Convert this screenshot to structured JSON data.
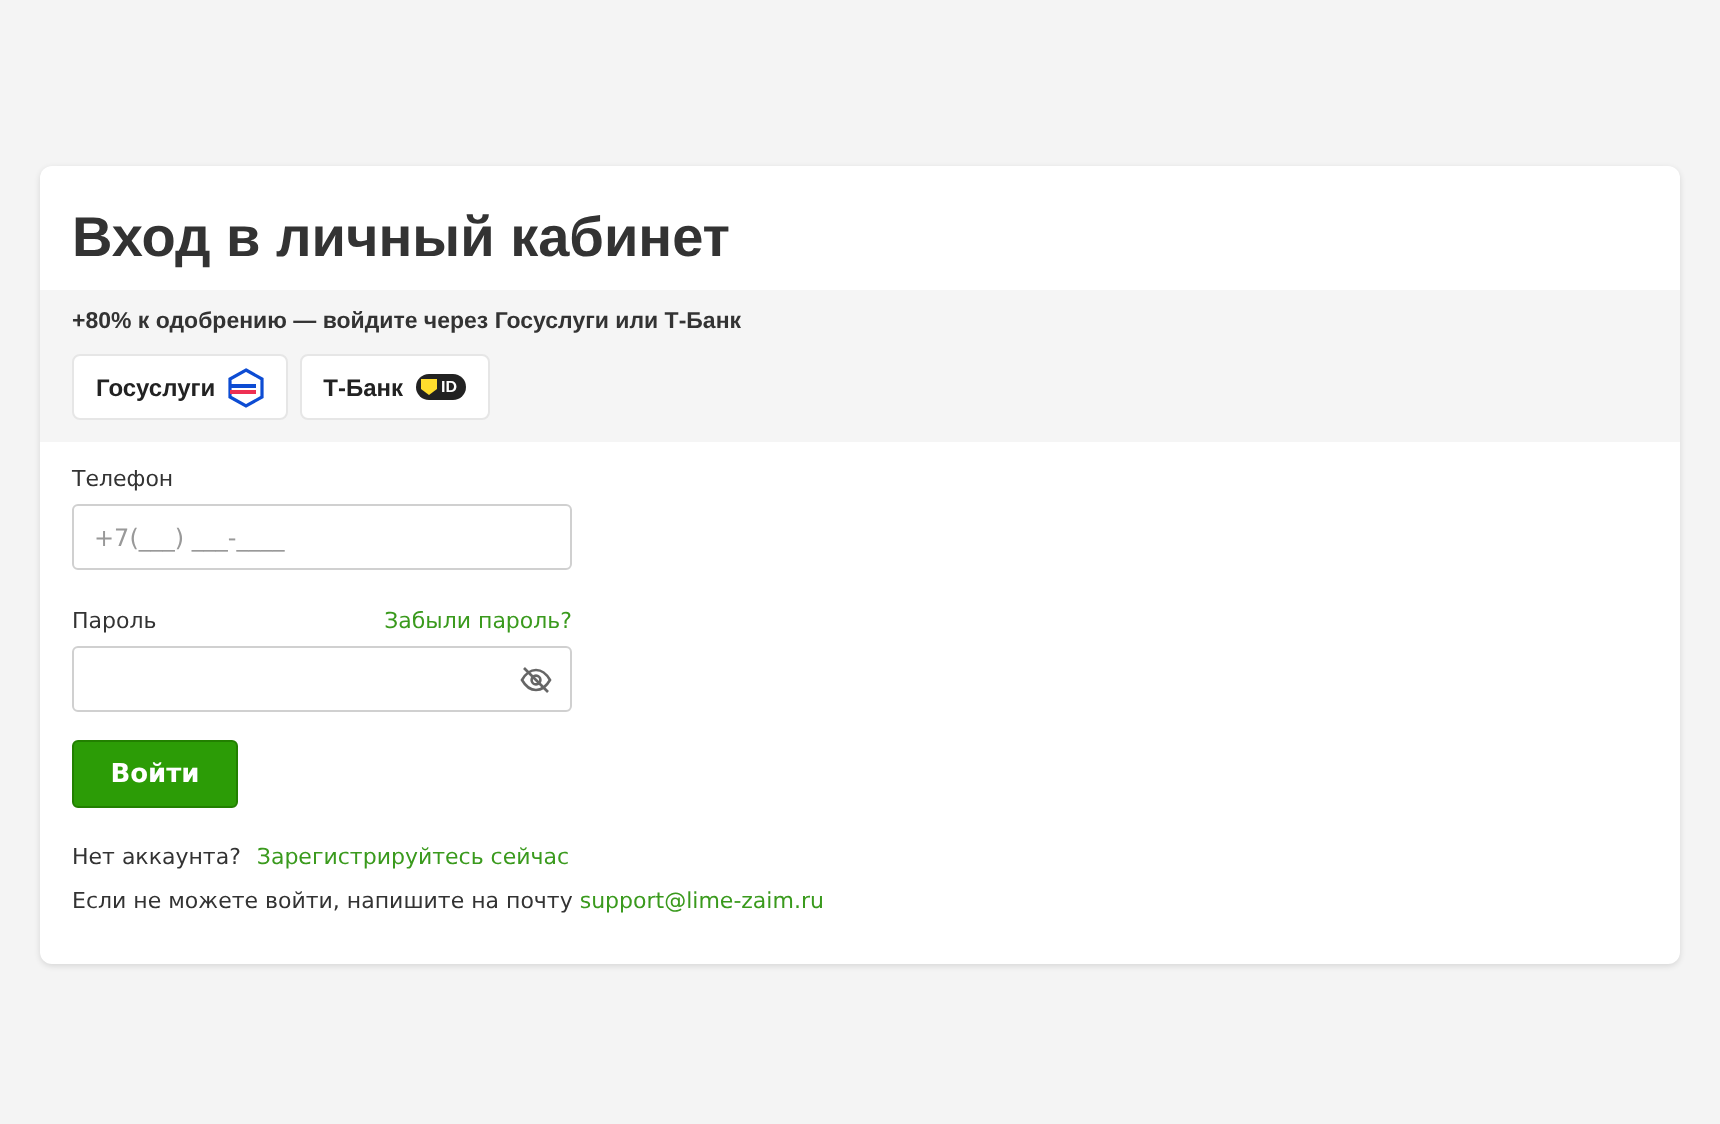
{
  "title": "Вход в личный кабинет",
  "promo": {
    "text": "+80% к одобрению — войдите через Госуслуги или Т-Банк",
    "providers": [
      {
        "kind": "gosuslugi",
        "label": "Госуслуги"
      },
      {
        "kind": "tbank",
        "label": "Т-Банк",
        "badge": "ID"
      }
    ]
  },
  "phone": {
    "label": "Телефон",
    "placeholder": "+7(___) ___-____"
  },
  "password": {
    "label": "Пароль",
    "forgot_link": "Забыли пароль?"
  },
  "submit": "Войти",
  "register": {
    "text": "Нет аккаунта?",
    "link": "Зарегистрируйтесь сейчас"
  },
  "support": {
    "text": "Если не можете войти, напишите на почту",
    "link": "support@lime-zaim.ru"
  }
}
